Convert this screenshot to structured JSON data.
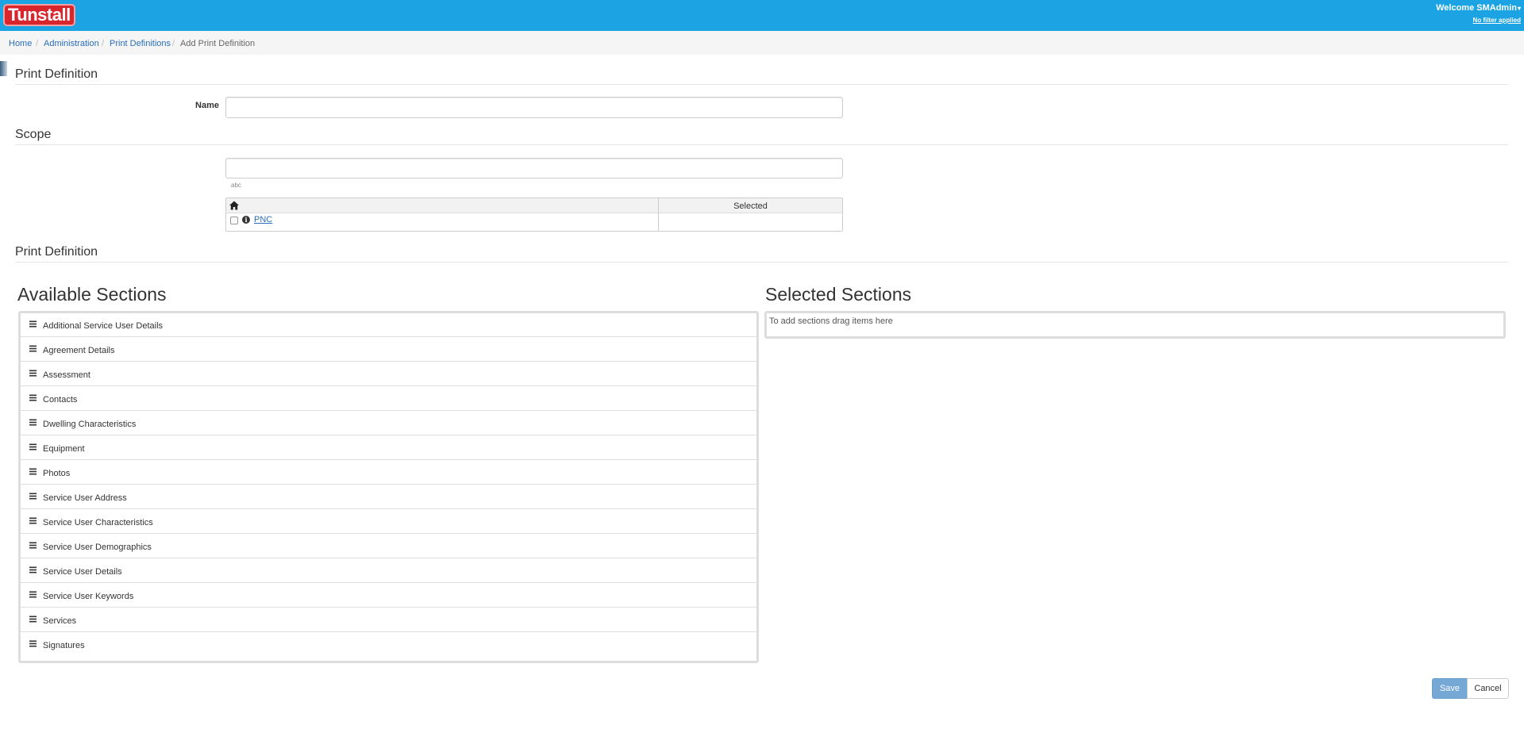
{
  "header": {
    "logo_text": "Tunstall",
    "welcome_text": "Welcome SMAdmin",
    "filter_text": "No filter applied",
    "bar_color": "#1ca3e4",
    "logo_color": "#d9252c"
  },
  "breadcrumb": {
    "home": "Home",
    "administration": "Administration",
    "print_definitions": "Print Definitions",
    "current": "Add Print Definition",
    "separator": "/"
  },
  "form": {
    "section_print_definition": "Print Definition",
    "name_label": "Name",
    "name_value": "",
    "section_scope": "Scope",
    "scope_search_value": "",
    "scope_hint": "abc",
    "scope_table": {
      "home_icon": "home-icon",
      "selected_header": "Selected",
      "rows": [
        {
          "label": "PNC",
          "checked": false,
          "icon": "info-circle-icon"
        }
      ]
    },
    "section_print_definition_2": "Print Definition"
  },
  "sections": {
    "available_title": "Available Sections",
    "selected_title": "Selected Sections",
    "available_items": [
      "Additional Service User Details",
      "Agreement Details",
      "Assessment",
      "Contacts",
      "Dwelling Characteristics",
      "Equipment",
      "Photos",
      "Service User Address",
      "Service User Characteristics",
      "Service User Demographics",
      "Service User Details",
      "Service User Keywords",
      "Services",
      "Signatures"
    ],
    "selected_placeholder": "To add sections drag items here"
  },
  "actions": {
    "save_label": "Save",
    "cancel_label": "Cancel",
    "save_color": "#76a8d6"
  }
}
